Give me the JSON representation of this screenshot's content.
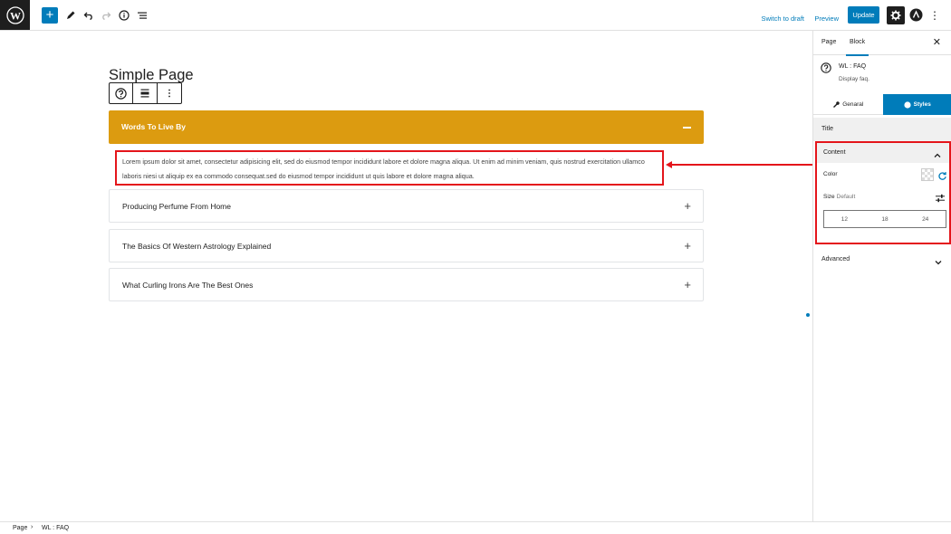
{
  "toolbar": {
    "add_label": "+",
    "switch_to_draft": "Switch to draft",
    "preview": "Preview",
    "update": "Update"
  },
  "page": {
    "title": "Simple Page"
  },
  "faq": {
    "items": [
      {
        "question": "Words To Live By",
        "answer": "Lorem ipsum dolor sit amet, consectetur adipisicing elit, sed do eiusmod tempor incididunt labore et dolore magna aliqua. Ut enim ad minim veniam, quis nostrud exercitation ullamco laboris niesi ut aliquip ex ea commodo consequat.sed do eiusmod tempor incididunt ut quis labore et dolore magna aliqua.",
        "expanded": true
      },
      {
        "question": "Producing Perfume From Home",
        "expanded": false
      },
      {
        "question": "The Basics Of Western Astrology Explained",
        "expanded": false
      },
      {
        "question": "What Curling Irons Are The Best Ones",
        "expanded": false
      }
    ],
    "active_color": "#dc9b10"
  },
  "sidebar": {
    "tabs": {
      "page": "Page",
      "block": "Block"
    },
    "block_name": "WL : FAQ",
    "block_desc": "Display faq.",
    "style_tabs": {
      "general": "Genaral",
      "styles": "Styles"
    },
    "panels": {
      "title": "Title",
      "content": "Content",
      "advanced": "Advanced"
    },
    "content": {
      "color_label": "Color",
      "size_label": "Size",
      "size_default": "Default",
      "size_options": [
        "12",
        "18",
        "24"
      ]
    }
  },
  "breadcrumb": {
    "items": [
      "Page",
      "WL : FAQ"
    ],
    "separator": "›"
  },
  "colors": {
    "accent": "#007cba",
    "highlight": "#e4151b"
  }
}
